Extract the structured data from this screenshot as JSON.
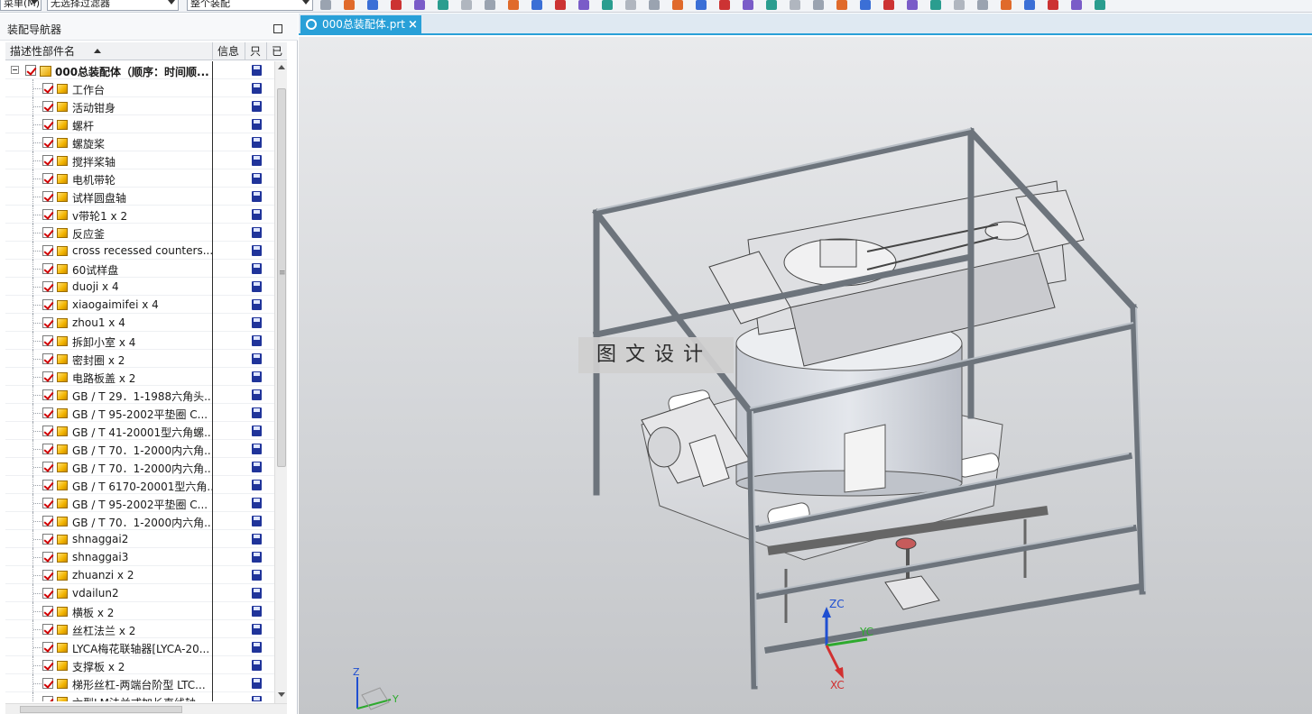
{
  "toolbar": {
    "filter_combo": "无选择过滤器",
    "assembly_combo": "整个装配",
    "left_combo": "菜单(M)"
  },
  "navigator": {
    "title": "装配导航器",
    "columns": {
      "name": "描述性部件名",
      "info": "信息",
      "readonly": "只",
      "modified": "已"
    },
    "root": "000总装配体（顺序：时间顺...",
    "items": [
      "工作台",
      "活动钳身",
      "螺杆",
      "螺旋桨",
      "搅拌桨轴",
      "电机带轮",
      "试样圆盘轴",
      "v带轮1 x 2",
      "反应釜",
      "cross recessed counters...",
      "60试样盘",
      "duoji x 4",
      "xiaogaimifei x 4",
      "zhou1 x 4",
      "拆卸小室 x 4",
      "密封圈 x 2",
      "电路板盖 x 2",
      "GB / T 29．1-1988六角头...",
      "GB / T 95-2002平垫圈 C...",
      "GB / T 41-20001型六角螺...",
      "GB / T 70．1-2000内六角...",
      "GB / T 70．1-2000内六角...",
      "GB / T 6170-20001型六角...",
      "GB / T 95-2002平垫圈 C...",
      "GB / T 70．1-2000内六角...",
      "shnaggai2",
      "shnaggai3",
      "zhuanzi x 2",
      "vdailun2",
      "横板 x 2",
      "丝杠法兰 x 2",
      "LYCA梅花联轴器[LYCA-20...",
      "支撑板 x 2",
      "梯形丝杠-两端台阶型 LTC...",
      "六型LM法兰式加长直线轴..."
    ]
  },
  "graphics": {
    "tab_title": "000总装配体.prt",
    "watermark": "图文设计",
    "csys_labels": {
      "zc": "ZC",
      "xc": "XC",
      "yc": "YC"
    },
    "triad_labels": {
      "z": "Z",
      "y": "Y"
    }
  },
  "colors": {
    "tab_active": "#29a0d8",
    "checkbox_check": "#d10000",
    "save_icon": "#20349a",
    "frame_steel": "#8e969e"
  }
}
